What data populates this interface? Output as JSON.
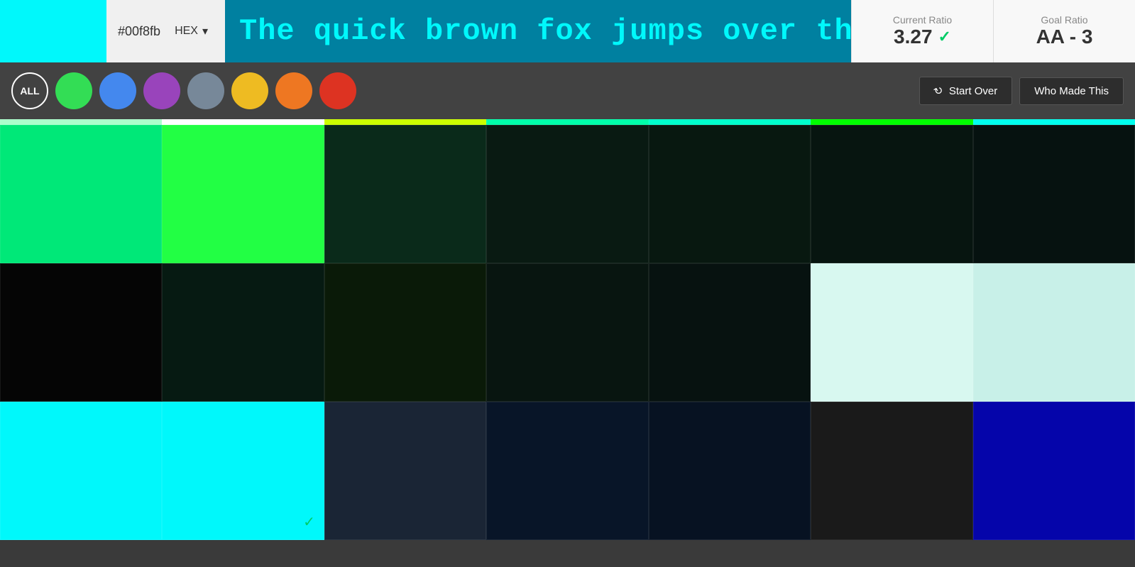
{
  "header": {
    "color_preview_bg": "#00f8fb",
    "hex_value": "#00f8fb",
    "hex_label": "HEX",
    "preview_text": "The quick brown fox jumps over the lazy",
    "preview_text_bg": "#0080a0",
    "preview_text_color": "#00f8fb",
    "current_ratio_label": "Current Ratio",
    "current_ratio_value": "3.27",
    "current_ratio_check": "✓",
    "goal_ratio_label": "Goal Ratio",
    "goal_ratio_value": "AA - 3"
  },
  "filter_bar": {
    "all_label": "ALL",
    "circles": [
      {
        "color": "#33dd55",
        "name": "green"
      },
      {
        "color": "#4488ee",
        "name": "blue"
      },
      {
        "color": "#9944bb",
        "name": "purple"
      },
      {
        "color": "#778899",
        "name": "gray"
      },
      {
        "color": "#eebb22",
        "name": "yellow"
      },
      {
        "color": "#ee7722",
        "name": "orange"
      },
      {
        "color": "#dd3322",
        "name": "red"
      }
    ],
    "start_over_label": "Start Over",
    "who_made_label": "Who Made This"
  },
  "thin_row": [
    "#00ff88",
    "#ffffff",
    "#ccff00",
    "#00ffaa",
    "#00ffcc",
    "#00ff00",
    "#00ffee"
  ],
  "color_grid": {
    "rows": [
      [
        {
          "bg": "#00e878",
          "check": false
        },
        {
          "bg": "#22ff44",
          "check": false
        },
        {
          "bg": "#0a2a1a",
          "check": false
        },
        {
          "bg": "#091a12",
          "check": false
        },
        {
          "bg": "#081810",
          "check": false
        },
        {
          "bg": "#071510",
          "check": false
        },
        {
          "bg": "#061210",
          "check": false
        }
      ],
      [
        {
          "bg": "#050505",
          "check": false
        },
        {
          "bg": "#061a12",
          "check": false
        },
        {
          "bg": "#0a1a08",
          "check": false
        },
        {
          "bg": "#081510",
          "check": false
        },
        {
          "bg": "#071210",
          "check": false
        },
        {
          "bg": "#d8f8f0",
          "check": false
        },
        {
          "bg": "#c8f0e8",
          "check": false
        }
      ],
      [
        {
          "bg": "#00f8fb",
          "check": true
        },
        {
          "bg": "#00f8fb",
          "check": true
        },
        {
          "bg": "#1a2535",
          "check": false
        },
        {
          "bg": "#081528",
          "check": false
        },
        {
          "bg": "#071222",
          "check": false
        },
        {
          "bg": "#1a1a1a",
          "check": false
        },
        {
          "bg": "#081515",
          "check": false
        }
      ]
    ]
  }
}
